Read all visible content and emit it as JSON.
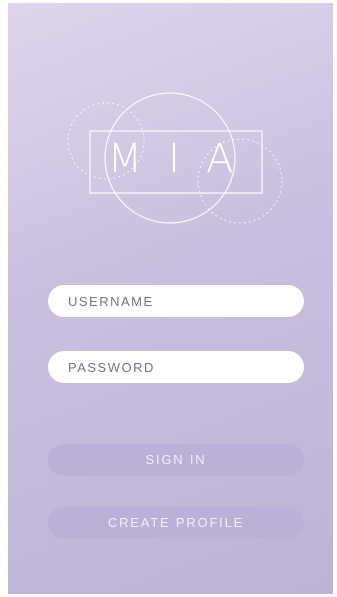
{
  "logo": {
    "text": "MIA"
  },
  "form": {
    "username_placeholder": "USERNAME",
    "password_placeholder": "PASSWORD"
  },
  "buttons": {
    "sign_in": "SIGN IN",
    "create_profile": "CREATE PROFILE"
  },
  "colors": {
    "background_top": "#ded5ea",
    "background_bottom": "#bdb3d5",
    "button_fill": "#bbb0d8",
    "field_fill": "#ffffff"
  }
}
